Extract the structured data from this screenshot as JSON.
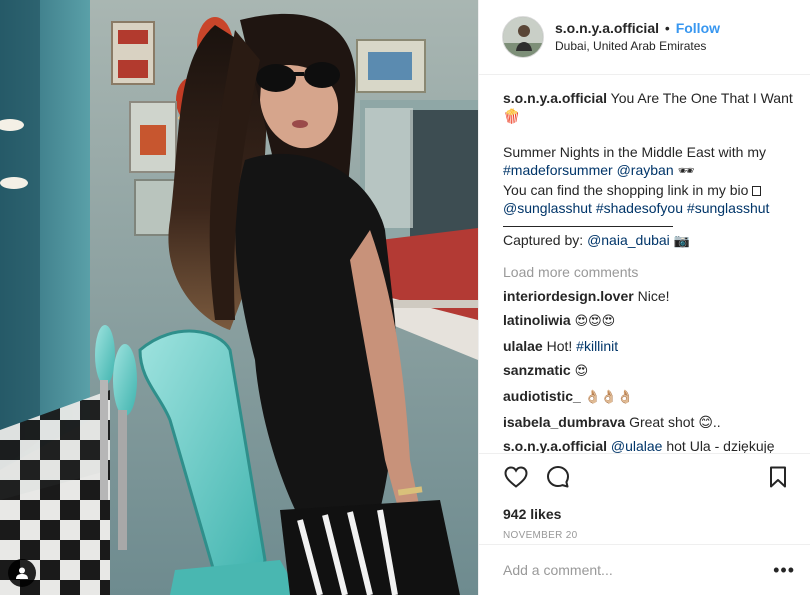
{
  "post": {
    "username": "s.o.n.y.a.official",
    "follow_label": "Follow",
    "location": "Dubai, United Arab Emirates",
    "caption": {
      "username": "s.o.n.y.a.official",
      "line1": "You Are The One That I Want 🍿",
      "line2": "Summer Nights in the Middle East with my ",
      "hashtag1": "#madeforsummer",
      "mention1": "@rayban",
      "line2_end": " 🕶",
      "line3": "You can find the shopping link in my bio ",
      "mention2": "@sunglasshut",
      "hashtag2": "#shadesofyou",
      "hashtag3": "#sunglasshut",
      "credit_label": "Captured by: ",
      "credit_mention": "@naia_dubai",
      "credit_emoji": "📷"
    },
    "load_more": "Load more comments",
    "comments": [
      {
        "user": "interiordesign.lover",
        "text": "Nice!"
      },
      {
        "user": "latinoliwia",
        "text": "😍😍😍"
      },
      {
        "user": "ulalae",
        "text": "Hot! ",
        "tag": "#killinit"
      },
      {
        "user": "sanzmatic",
        "text": "😍"
      },
      {
        "user": "audiotistic_",
        "text": "👌🏼👌🏼👌🏼"
      },
      {
        "user": "isabela_dumbrava",
        "text": "Great shot 😊.."
      },
      {
        "user": "s.o.n.y.a.official",
        "mention": "@ulalae",
        "text": " hot Ula - dziękuję"
      }
    ],
    "likes": "942 likes",
    "date": "NOVEMBER 20",
    "add_comment_placeholder": "Add a comment...",
    "more_icon": "•••"
  },
  "colors": {
    "link": "#003569",
    "follow": "#3897f0",
    "muted": "#999999",
    "border": "#efefef"
  },
  "icons": [
    "user-tag-icon",
    "heart-icon",
    "comment-icon",
    "bookmark-icon",
    "more-options-icon"
  ]
}
